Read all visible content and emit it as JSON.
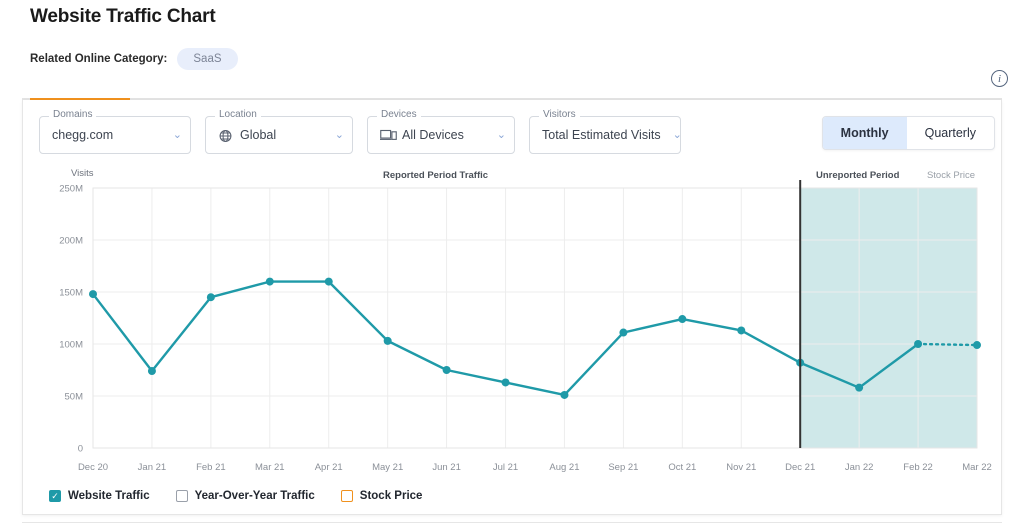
{
  "header": {
    "title": "Website Traffic Chart",
    "category_label": "Related Online Category:",
    "category_value": "SaaS",
    "info_icon": "info-icon",
    "info_glyph": "i"
  },
  "filters": [
    {
      "legend": "Domains",
      "value": "chegg.com",
      "icon": "",
      "name": "domains"
    },
    {
      "legend": "Location",
      "value": "Global",
      "icon": "globe-icon",
      "name": "location"
    },
    {
      "legend": "Devices",
      "value": "All Devices",
      "icon": "device-icon",
      "name": "devices"
    },
    {
      "legend": "Visitors",
      "value": "Total Estimated Visits",
      "icon": "",
      "name": "visitors"
    }
  ],
  "chevron_glyph": "⌄",
  "period_toggle": {
    "options": [
      "Monthly",
      "Quarterly"
    ],
    "selected": "Monthly"
  },
  "captions": {
    "y_axis": "Visits",
    "reported": "Reported Period Traffic",
    "unreported": "Unreported Period",
    "stock_price": "Stock Price"
  },
  "legend": [
    {
      "label": "Website Traffic",
      "checked": true,
      "color": "#1f9aa8",
      "style": "on"
    },
    {
      "label": "Year-Over-Year Traffic",
      "checked": false,
      "color": "#9aa0aa",
      "style": "off"
    },
    {
      "label": "Stock Price",
      "checked": false,
      "color": "#f0911e",
      "style": "orange"
    }
  ],
  "colors": {
    "line": "#1f9aa8",
    "unreported_band": "#cfe8e9",
    "divider": "#333333",
    "accent_orange": "#f0911e",
    "grid": "#ededed"
  },
  "chart_data": {
    "type": "line",
    "title": "Website Traffic Chart",
    "xlabel": "",
    "ylabel": "Visits",
    "ylim": [
      0,
      250000000
    ],
    "ytick_labels": [
      "0",
      "50M",
      "100M",
      "150M",
      "200M",
      "250M"
    ],
    "ytick_values": [
      0,
      50000000,
      100000000,
      150000000,
      200000000,
      250000000
    ],
    "grid": true,
    "legend_position": "bottom-left",
    "categories": [
      "Dec 20",
      "Jan 21",
      "Feb 21",
      "Mar 21",
      "Apr 21",
      "May 21",
      "Jun 21",
      "Jul 21",
      "Aug 21",
      "Sep 21",
      "Oct 21",
      "Nov 21",
      "Dec 21",
      "Jan 22",
      "Feb 22",
      "Mar 22"
    ],
    "series": [
      {
        "name": "Website Traffic",
        "color": "#1f9aa8",
        "values": [
          148000000,
          74000000,
          145000000,
          160000000,
          160000000,
          103000000,
          75000000,
          63000000,
          51000000,
          111000000,
          124000000,
          113000000,
          82000000,
          58000000,
          100000000,
          99000000
        ]
      }
    ],
    "annotations": {
      "unreported_start_category": "Dec 21",
      "unreported_label": "Unreported Period",
      "reported_label": "Reported Period Traffic",
      "dotted_segment": [
        "Feb 22",
        "Mar 22"
      ]
    }
  }
}
